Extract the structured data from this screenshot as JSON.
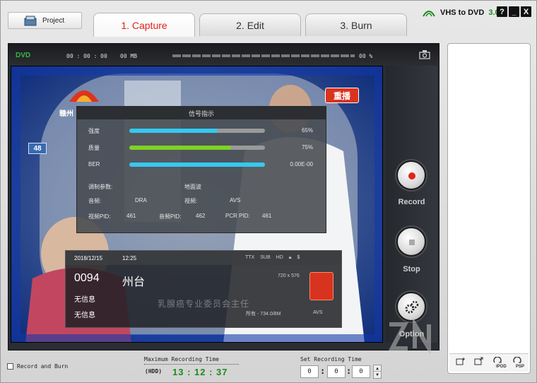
{
  "header": {
    "project_label": "Project",
    "tabs": [
      {
        "label": "1. Capture",
        "active": true
      },
      {
        "label": "2. Edit",
        "active": false
      },
      {
        "label": "3. Burn",
        "active": false
      }
    ],
    "brand": {
      "name": "VHS to DVD",
      "version": "3.0"
    },
    "window_buttons": [
      "?",
      "_",
      "X"
    ]
  },
  "status": {
    "format": "DVD",
    "time": "00 : 00 : 00",
    "size": "00 MB",
    "progress_percent": 0,
    "percent_text": "00 %"
  },
  "video": {
    "channel_logo_text": "赣州",
    "replay_badge": "重播",
    "side_number": "48",
    "signal": {
      "title": "信号指示",
      "rows": [
        {
          "label": "强度",
          "value": "65%",
          "fill": 0.65,
          "color": "#35c9f0"
        },
        {
          "label": "质量",
          "value": "75%",
          "fill": 0.75,
          "color": "#7ed321"
        },
        {
          "label": "BER",
          "value": "0.00E-00",
          "fill": 1.0,
          "color": "#35c9f0"
        }
      ],
      "params": {
        "mod_label": "调制参数:",
        "mod_value": "地面波",
        "audio_label": "音频:",
        "audio_value": "DRA",
        "video_label": "视频:",
        "video_value": "AVS",
        "vpid_label": "视频PID:",
        "vpid_value": "461",
        "apid_label": "音频PID:",
        "apid_value": "462",
        "pcr_label": "PCR PID:",
        "pcr_value": "461"
      }
    },
    "channel_info": {
      "date": "2018/12/15",
      "clock": "12:25",
      "tags": [
        "TTX",
        "SUB",
        "HD"
      ],
      "number": "0094",
      "name": "州台",
      "resolution": "720 x 576",
      "no_info_1": "无信息",
      "no_info_2": "无信息",
      "subtitle": "乳腺癌专业委员会主任",
      "footer": "所有 - 734.0/8M",
      "codec": "AVS"
    }
  },
  "controls": {
    "record_label": "Record",
    "stop_label": "Stop",
    "option_label": "Option",
    "accent": "#e2231a"
  },
  "right_tools": {
    "ipod_label": "IPOD",
    "psp_label": "PSP"
  },
  "bottom": {
    "record_and_burn_label": "Record and Burn",
    "record_and_burn_checked": false,
    "max_recording_label": "Maximum Recording Time",
    "hdd_label": "(HDD)",
    "max_recording_time": "13 : 12 : 37",
    "set_recording_label": "Set Recording Time",
    "set_h": "0",
    "set_m": "0",
    "set_s": "0"
  }
}
